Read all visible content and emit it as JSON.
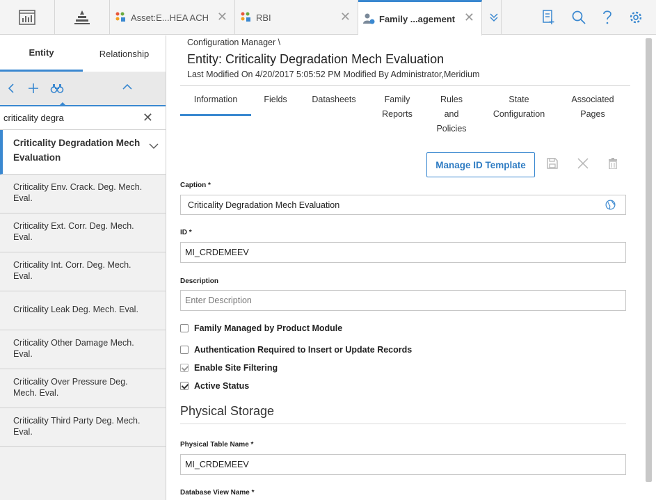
{
  "topbar": {
    "tabs": [
      {
        "label": "Asset:E...HEA ACH",
        "active": false
      },
      {
        "label": "RBI",
        "active": false
      },
      {
        "label": "Family ...agement",
        "active": true
      }
    ]
  },
  "left_panel": {
    "tabs": [
      "Entity",
      "Relationship"
    ],
    "search_value": "criticality degra",
    "items": [
      {
        "label": "Criticality Degradation Mech Evaluation",
        "selected": true
      },
      {
        "label": "Criticality Env. Crack. Deg. Mech. Eval."
      },
      {
        "label": "Criticality Ext. Corr. Deg. Mech. Eval."
      },
      {
        "label": "Criticality Int. Corr. Deg. Mech. Eval."
      },
      {
        "label": "Criticality Leak Deg. Mech. Eval."
      },
      {
        "label": "Criticality Other Damage Mech. Eval."
      },
      {
        "label": "Criticality Over Pressure Deg. Mech. Eval."
      },
      {
        "label": "Criticality Third Party Deg. Mech. Eval."
      }
    ]
  },
  "main": {
    "breadcrumb": "Configuration Manager \\",
    "title": "Entity: Criticality Degradation Mech Evaluation",
    "modified": "Last Modified On 4/20/2017 5:05:52 PM Modified By Administrator,Meridium",
    "tabs": [
      {
        "label": "Information"
      },
      {
        "label": "Fields"
      },
      {
        "label": "Datasheets"
      },
      {
        "label": "Family Reports"
      },
      {
        "label": "Rules and Policies"
      },
      {
        "label": "State Configuration"
      },
      {
        "label": "Associated Pages"
      }
    ],
    "manage_id_label": "Manage ID Template",
    "caption_label": "Caption *",
    "caption_value": "Criticality Degradation Mech Evaluation",
    "id_label": "ID *",
    "id_value": "MI_CRDEMEEV",
    "description_label": "Description",
    "description_placeholder": "Enter Description",
    "checkboxes": [
      {
        "label": "Family Managed by Product Module",
        "checked": false
      },
      {
        "label": "Authentication Required to Insert or Update Records",
        "checked": false
      },
      {
        "label": "Enable Site Filtering",
        "checked": true
      },
      {
        "label": "Active Status",
        "checked": true
      }
    ],
    "section_title": "Physical Storage",
    "physical_table_label": "Physical Table Name *",
    "physical_table_value": "MI_CRDEMEEV",
    "db_view_label": "Database View Name *"
  },
  "colors": {
    "accent": "#3a88d0"
  }
}
